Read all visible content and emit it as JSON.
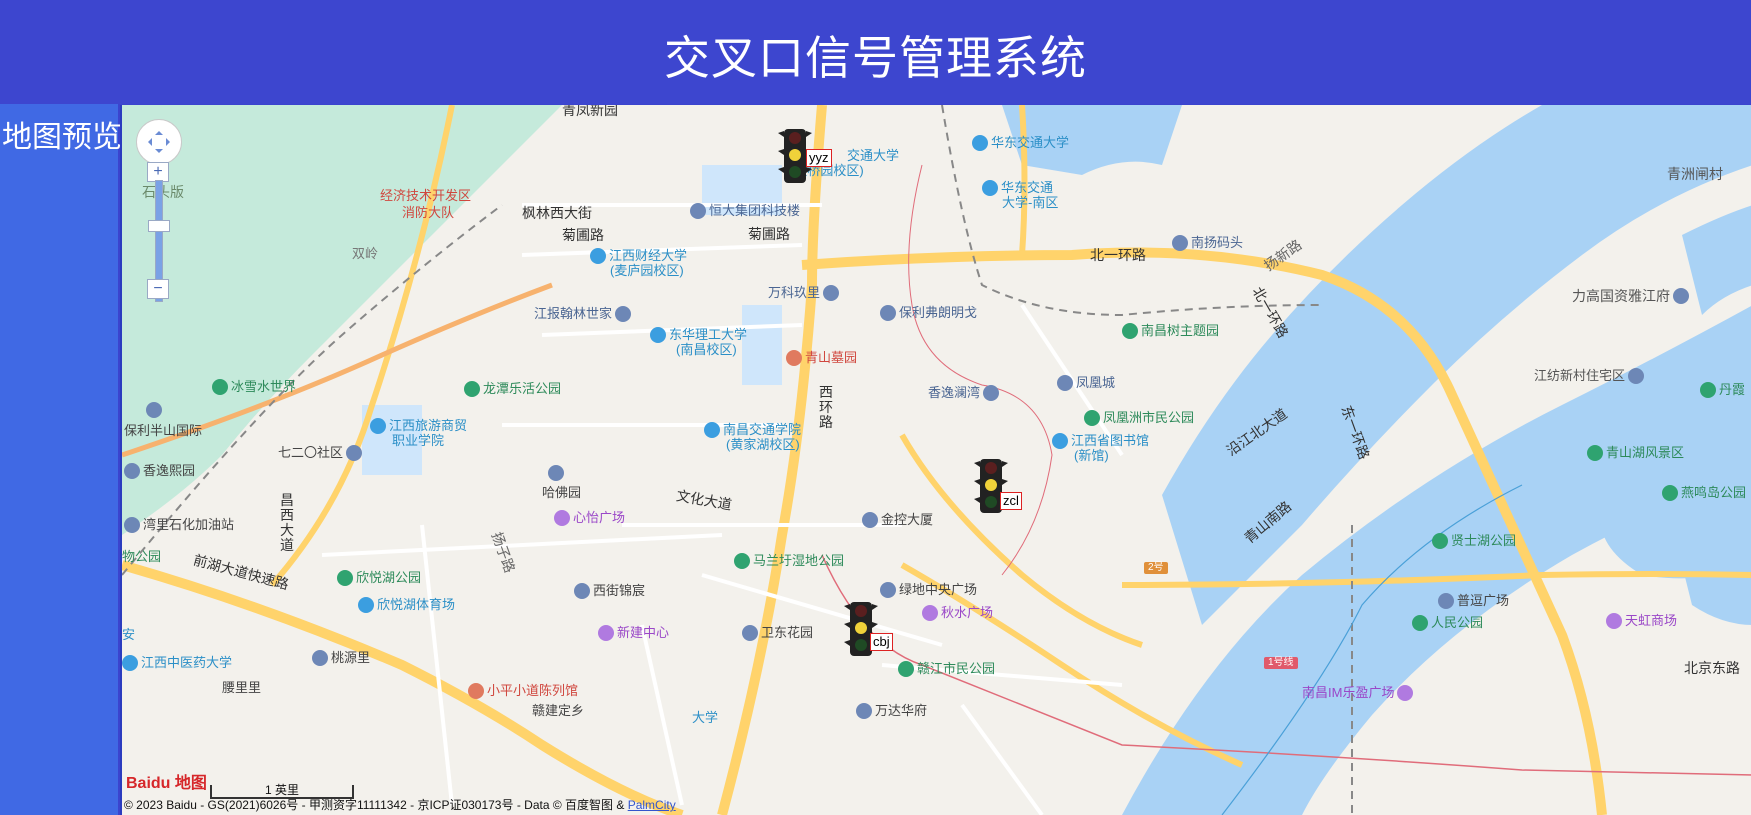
{
  "header": {
    "title": "交叉口信号管理系统"
  },
  "sidebar": {
    "label": "地图预览"
  },
  "map": {
    "controls": {
      "zoom_in": "+",
      "zoom_out": "−"
    },
    "scale_label": "1 英里",
    "logo": "Baidu 地图",
    "copyright": "© 2023 Baidu - GS(2021)6026号 - 甲测资字11111342 - 京ICP证030173号 - Data © 百度智图 & ",
    "copyright_link": "PalmCity",
    "intersections": [
      {
        "label": "yyz"
      },
      {
        "label": "zcl"
      },
      {
        "label": "cbj"
      }
    ],
    "labels": {
      "qingfeng": "青凤新园",
      "shiban": "石头版",
      "jingji": "经济技术开发区",
      "xiaofang": "消防大队",
      "fenglin": "枫林西大街",
      "shuangling": "双岭",
      "changxi": "昌西大道",
      "julan": "菊圃路",
      "jiangcai": "江西财经大学",
      "jiangcai2": "(麦庐园校区)",
      "hengda": "恒大集团科技楼",
      "jupu2": "菊圃路",
      "jiangbao": "江报翰林世家",
      "wanke": "万科玖里",
      "jiaotong": "华东交通大学",
      "jiaotong_nan": "华东交通",
      "jiaotong_nan2": "大学-南区",
      "jiaoda_school": "交通大学",
      "jiaoda_school2": "(蛟桥园校区)",
      "baoli": "保利弗朗明戈",
      "nanyang": "南扬码头",
      "beiyihuan": "北一环路",
      "beiyihuan2": "北一环路",
      "yangxin": "扬新路",
      "qingzhou": "青洲闸村",
      "ligao": "力高国资雅江府",
      "donghua_ligong": "东华理工大学",
      "donghua_ligong2": "(南昌校区)",
      "qingshan_mu": "青山墓园",
      "nanchang_tree": "南昌树主题园",
      "bingxue": "冰雪水世界",
      "longtan": "龙潭乐活公园",
      "xihuan": "西环路",
      "xiangyi": "香逸澜湾",
      "fenghuang": "凤凰城",
      "fenghuangzhou": "凤凰洲市民公园",
      "library": "江西省图书馆",
      "library2": "(新馆)",
      "yanjiang": "沿江北大道",
      "donghuan": "东一环路",
      "jiangfang": "江纺新村住宅区",
      "danfeng": "丹霞",
      "qingshanhu": "青山湖风景区",
      "baoliban": "保利半山国际",
      "jiangxi_tour": "江西旅游商贸",
      "jiangxi_tour2": "职业学院",
      "nanchang_jt": "南昌交通学院",
      "nanchang_jt2": "(黄家湖校区)",
      "qierling": "七二〇社区",
      "xiangyi_park": "香逸熙园",
      "hanyao": "哈佛园",
      "wenhua": "文化大道",
      "changxi2": "昌西大道",
      "wanli": "湾里石化加油站",
      "shuiwu": "物公园",
      "xinyi": "心怡广场",
      "jinkong": "金控大厦",
      "qingshan_road": "青山南路",
      "yanming": "燕鸣岛公园",
      "xianshi": "贤士湖公园",
      "qianhu": "前湖大道快速路",
      "yangzi": "扬子路",
      "xinyue": "欣悦湖公园",
      "xinyue_sport": "欣悦湖体育场",
      "xijie": "西街锦宸",
      "malan": "马兰圩湿地公园",
      "lvdi": "绿地中央广场",
      "qiushui": "秋水广场",
      "puzheng": "普逗广场",
      "tianhong": "天虹商场",
      "renmin": "人民公园",
      "weidong": "卫东花园",
      "xinjian": "新建中心",
      "ganjiang": "赣江市民公园",
      "zhongyi": "江西中医药大学",
      "taoyuan": "桃源里",
      "yaoli": "腰里里",
      "xiaoping": "小平小道陈列馆",
      "wanda": "万达华府",
      "nanchang_im": "南昌IM乐盈广场",
      "beijing_road": "北京东路",
      "jiu": "赣建定乡",
      "univ": "大学",
      "an": "安"
    },
    "metro_label": "1号线",
    "hwy_label": "2号"
  }
}
